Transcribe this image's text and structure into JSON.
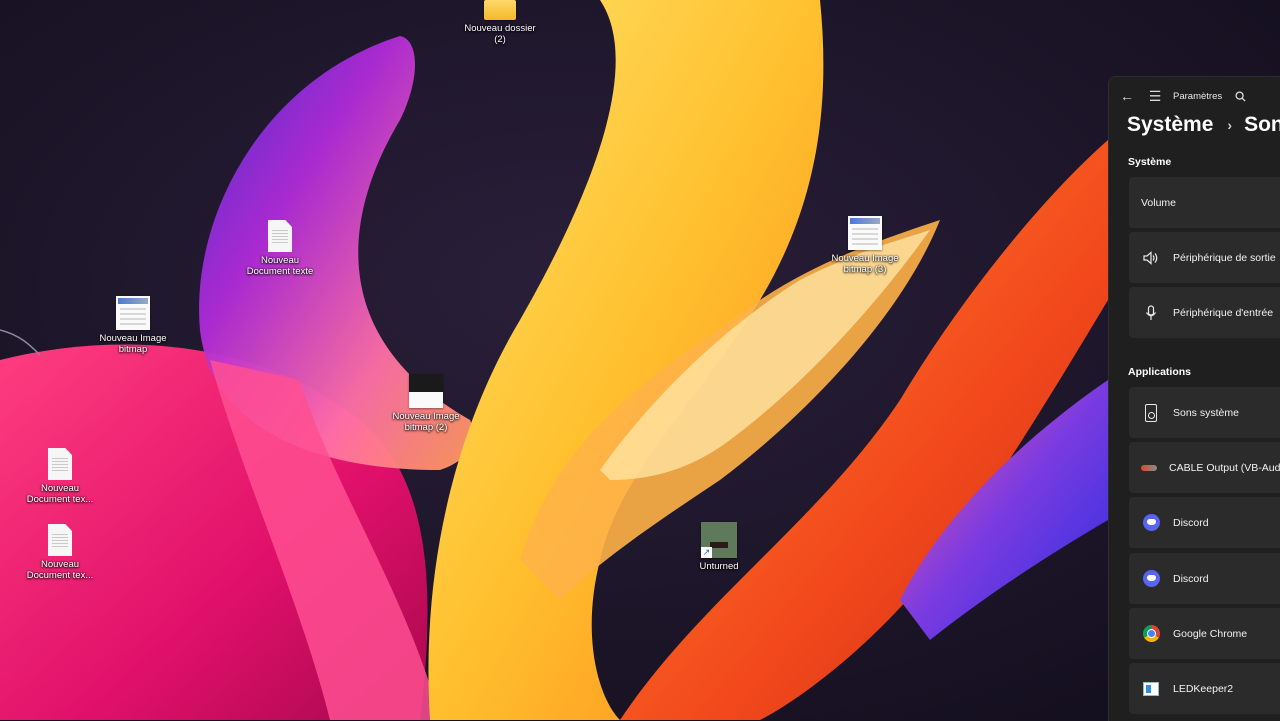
{
  "desktop": {
    "icons": [
      {
        "name": "desktop-icon-nouveau-dossier-2",
        "type": "folder",
        "label": "Nouveau dossier\n(2)"
      },
      {
        "name": "desktop-icon-nouveau-document-texte",
        "type": "document",
        "label": "Nouveau\nDocument texte"
      },
      {
        "name": "desktop-icon-nouveau-image-bitmap",
        "type": "bitmap",
        "label": "Nouveau Image\nbitmap"
      },
      {
        "name": "desktop-icon-nouveau-image-bitmap-2",
        "type": "bitmap",
        "label": "Nouveau Image\nbitmap (2)"
      },
      {
        "name": "desktop-icon-nouveau-image-bitmap-3",
        "type": "bitmap",
        "label": "Nouveau Image\nbitmap (3)"
      },
      {
        "name": "desktop-icon-nouveau-document-texte-a",
        "type": "document",
        "label": "Nouveau\nDocument tex..."
      },
      {
        "name": "desktop-icon-nouveau-document-texte-b",
        "type": "document",
        "label": "Nouveau\nDocument tex..."
      },
      {
        "name": "desktop-icon-unturned",
        "type": "game-shortcut",
        "label": "Unturned"
      }
    ]
  },
  "settings": {
    "title": "Paramètres",
    "breadcrumb": {
      "parent": "Système",
      "current": "Son"
    },
    "section_system": "Système",
    "section_apps": "Applications",
    "system_rows": [
      {
        "label": "Volume"
      },
      {
        "label": "Périphérique de sortie",
        "icon": "speaker-icon"
      },
      {
        "label": "Périphérique d'entrée",
        "icon": "microphone-icon"
      }
    ],
    "app_rows": [
      {
        "label": "Sons système",
        "icon": "system-sounds-icon"
      },
      {
        "label": "CABLE Output (VB-Audio Virtual Cable)",
        "icon": "cable-icon"
      },
      {
        "label": "Discord",
        "icon": "discord-icon"
      },
      {
        "label": "Discord",
        "icon": "discord-icon"
      },
      {
        "label": "Google Chrome",
        "icon": "chrome-icon"
      },
      {
        "label": "LEDKeeper2",
        "icon": "ledkeeper-icon"
      }
    ]
  }
}
